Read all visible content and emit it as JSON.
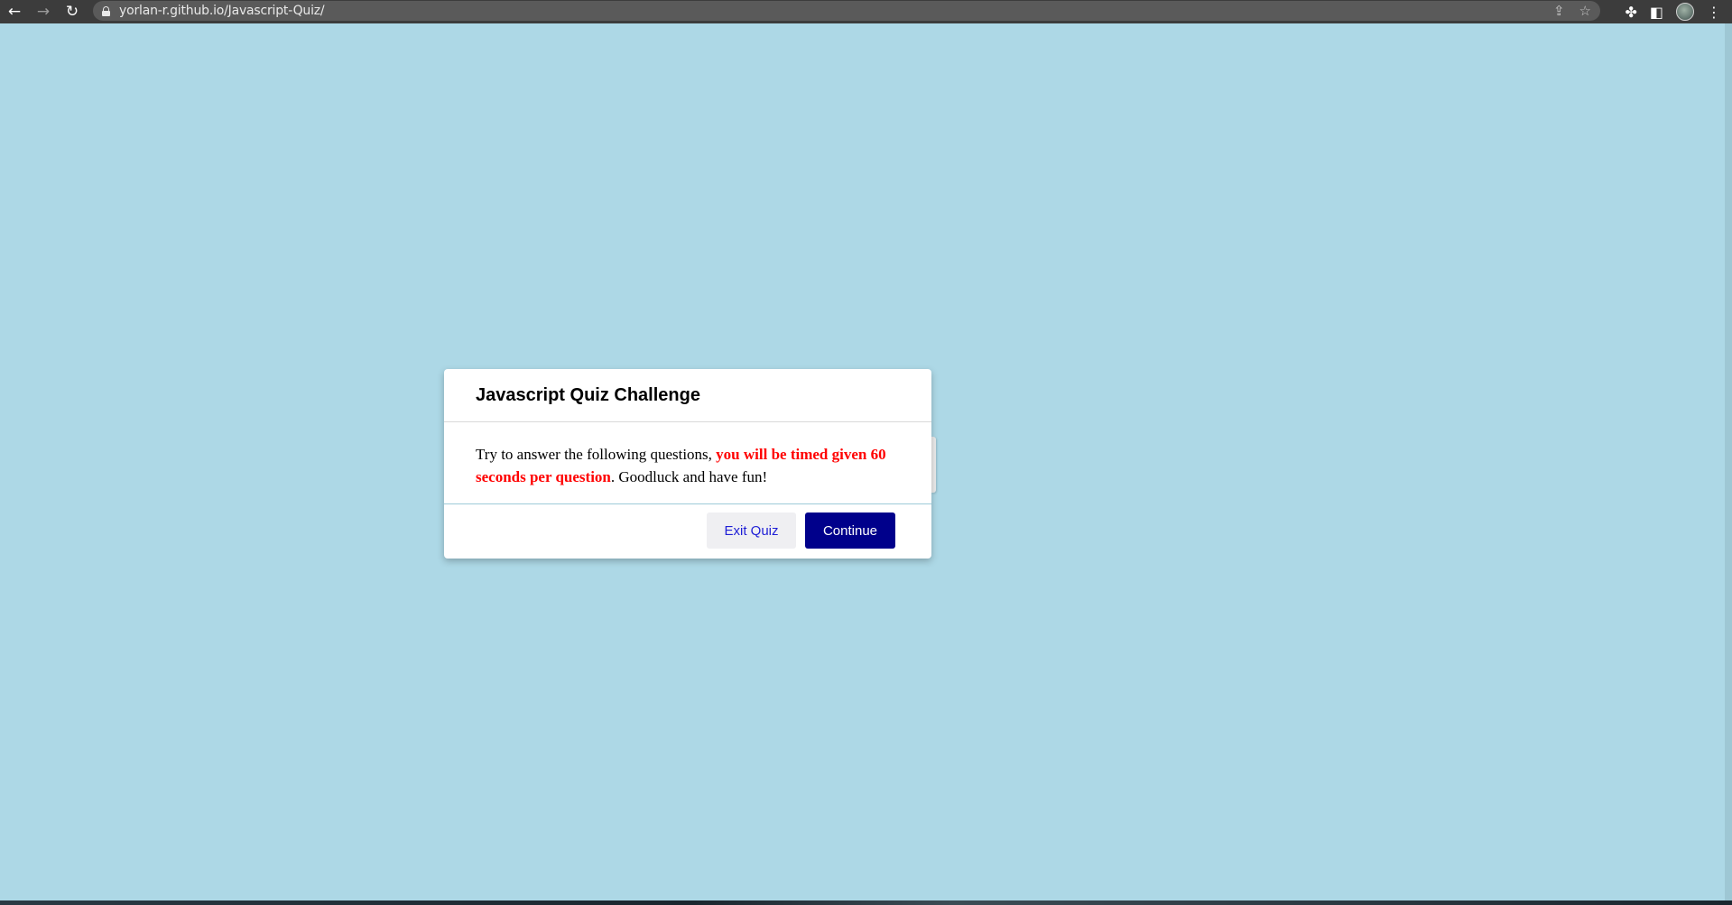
{
  "browser": {
    "url": "yorlan-r.github.io/Javascript-Quiz/",
    "back_icon": "←",
    "forward_icon": "→",
    "reload_icon": "↻",
    "share_icon": "⇪",
    "star_icon": "☆",
    "extensions_icon": "✤",
    "sidepanel_icon": "◧",
    "menu_icon": "⋮"
  },
  "modal": {
    "title": "Javascript Quiz Challenge",
    "body_prefix": "Try to answer the following questions, ",
    "body_highlight": "you will be timed given 60 seconds per question",
    "body_suffix": ". Goodluck and have fun!",
    "highlight_color": "#ff0000",
    "exit_label": "Exit Quiz",
    "continue_label": "Continue"
  },
  "colors": {
    "page_background": "#add8e6",
    "continue_button": "#00008b",
    "exit_text": "#1f1fd6"
  }
}
